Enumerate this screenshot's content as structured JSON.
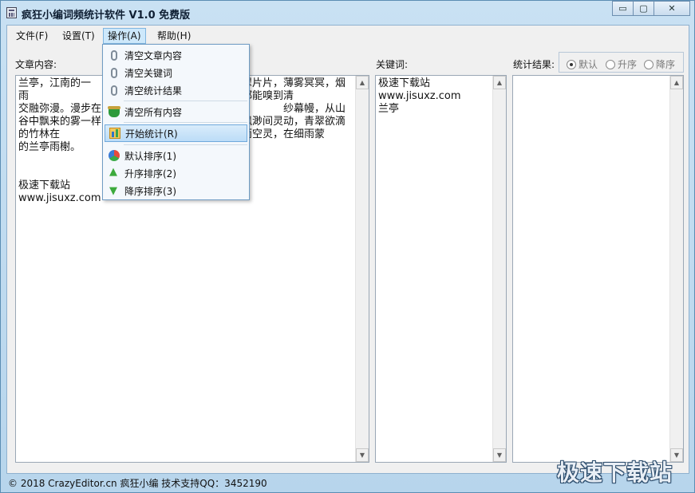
{
  "window": {
    "title": "疯狂小编词频统计软件 V1.0 免费版",
    "controls": {
      "minimize": "▭",
      "maximize": "▢",
      "close": "✕"
    }
  },
  "menubar": {
    "items": [
      {
        "label": "文件(F)"
      },
      {
        "label": "设置(T)"
      },
      {
        "label": "操作(A)"
      },
      {
        "label": "帮助(H)"
      }
    ]
  },
  "labels": {
    "article": "文章内容:",
    "keywords": "关键词:",
    "results": "统计结果:"
  },
  "result_sort_options": {
    "default": "默认",
    "asc": "升序",
    "desc": "降序",
    "selected": "默认"
  },
  "article_text": "兰亭，江南的一                              水潺潺，青翠片片，薄雾冥冥，烟雨                              林拂动瑟瑟琴弦，空气中都能嗅到清                              交融弥漫。漫步在兰亭竹径，我心悠                              纱幕幔，从山谷中飘来的雾一样的烟                              虚无飘渺间灵动，青翠欲滴的竹林在                              烟雨中的兰亭诗意而空灵，在细雨蒙                              的兰亭雨榭。\n\n\n极速下载站\nwww.jisuxz.com",
  "keywords_text": "极速下载站\nwww.jisuxz.com\n兰亭",
  "results_text": "",
  "operations_menu": {
    "items": [
      {
        "label": "清空文章内容"
      },
      {
        "label": "清空关键词"
      },
      {
        "label": "清空统计结果"
      },
      {
        "label": "清空所有内容"
      },
      {
        "label": "开始统计(R)"
      },
      {
        "label": "默认排序(1)"
      },
      {
        "label": "升序排序(2)"
      },
      {
        "label": "降序排序(3)"
      }
    ],
    "highlighted": "开始统计(R)"
  },
  "statusbar": {
    "text": "© 2018 CrazyEditor.cn 疯狂小编   技术支持QQ：3452190"
  },
  "watermark": "极速下载站"
}
